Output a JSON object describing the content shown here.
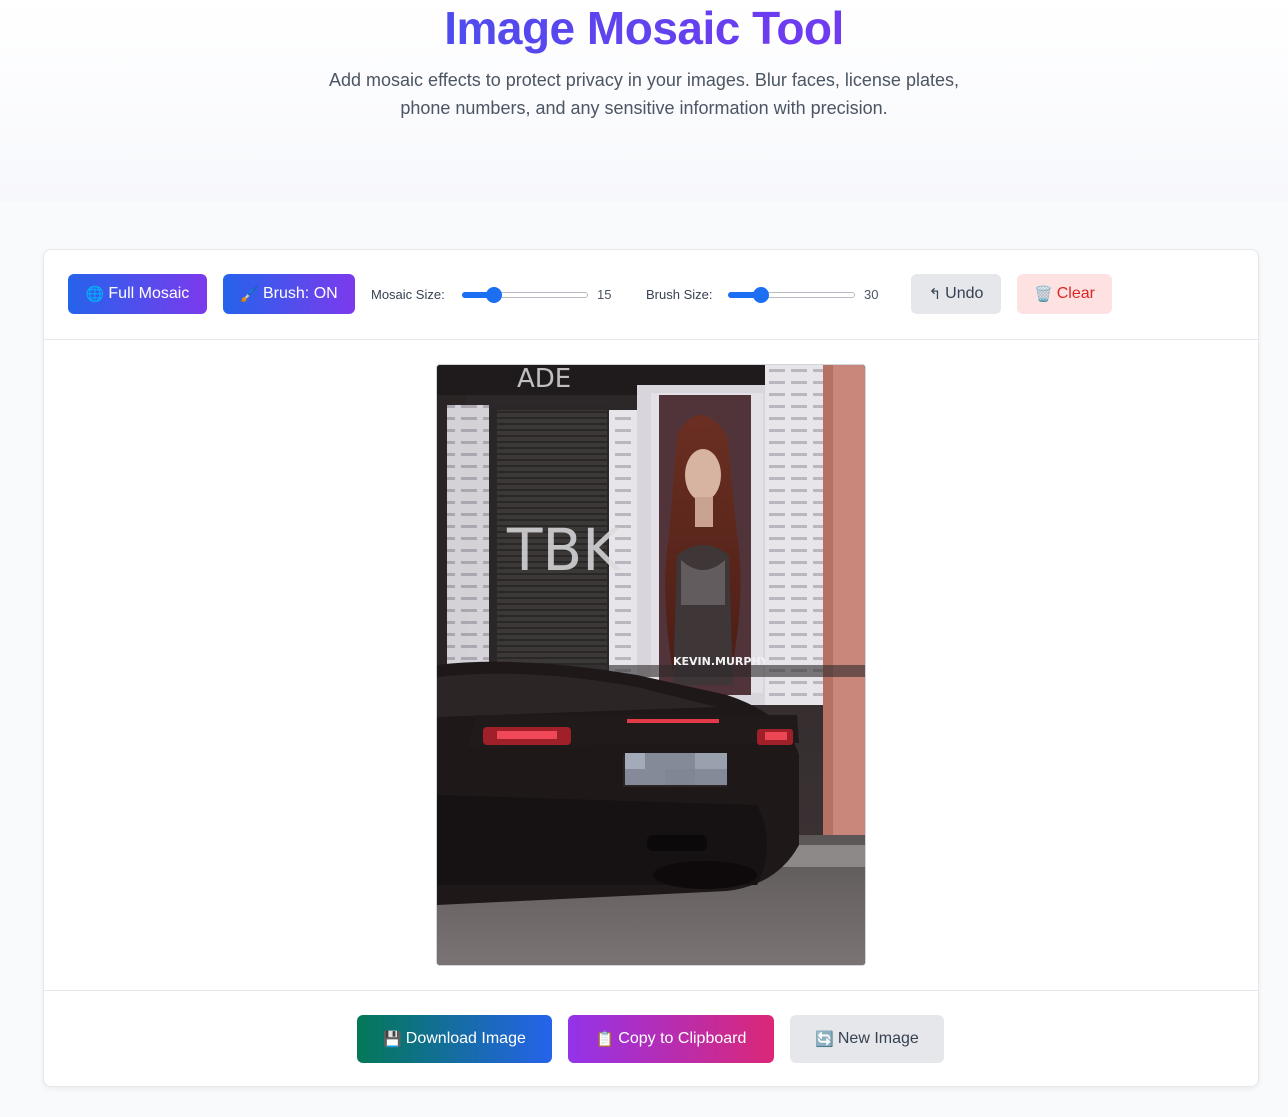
{
  "header": {
    "title": "Image Mosaic Tool",
    "subtitle": "Add mosaic effects to protect privacy in your images. Blur faces, license plates, phone numbers, and any sensitive information with precision."
  },
  "toolbar": {
    "full_mosaic": {
      "icon": "globe-icon",
      "label": "Full Mosaic"
    },
    "brush": {
      "icon": "brush-icon",
      "label": "Brush: ON"
    },
    "mosaic_size": {
      "label": "Mosaic Size:",
      "value": "15",
      "min": 5,
      "max": 50,
      "current": 15
    },
    "brush_size": {
      "label": "Brush Size:",
      "value": "30",
      "min": 10,
      "max": 100,
      "current": 30
    },
    "undo": {
      "icon": "undo-icon",
      "label": "Undo"
    },
    "clear": {
      "icon": "trash-icon",
      "label": "Clear"
    }
  },
  "image": {
    "shop_sign": "TBK",
    "poster_text": "KEVIN.MURPHY",
    "poster_pattern": "Kevin"
  },
  "actions": {
    "download": {
      "icon": "save-icon",
      "label": "Download Image"
    },
    "copy": {
      "icon": "clipboard-icon",
      "label": "Copy to Clipboard"
    },
    "new_image": {
      "icon": "refresh-icon",
      "label": "New Image"
    }
  },
  "colors": {
    "primary_start": "#2563eb",
    "primary_end": "#7c3aed",
    "slider": "#1c6ef2",
    "danger": "#dc2626"
  }
}
